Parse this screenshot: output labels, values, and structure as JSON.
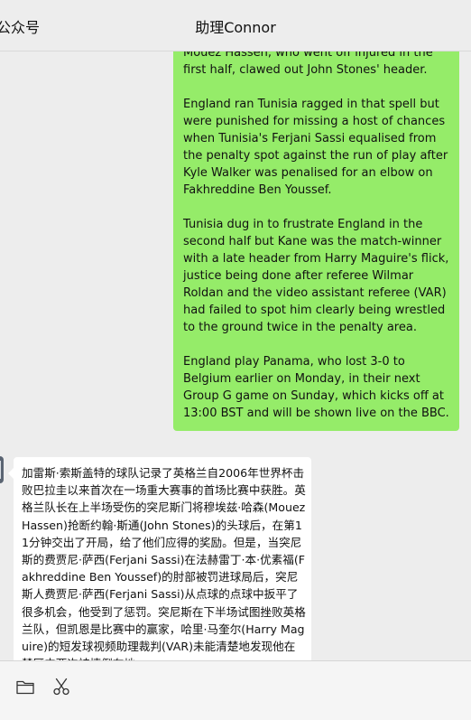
{
  "header": {
    "back_label": "公众号",
    "title": "助理Connor"
  },
  "messages": [
    {
      "direction": "out",
      "paragraphs": [
        "Mouez Hassen, who went off injured in the first half, clawed out John Stones' header.",
        "England ran Tunisia ragged in that spell but were punished for missing a host of chances when Tunisia's Ferjani Sassi equalised from the penalty spot against the run of play after Kyle Walker was penalised for an elbow on Fakhreddine Ben Youssef.",
        "Tunisia dug in to frustrate England in the second half but Kane was the match-winner with a late header from Harry Maguire's flick, justice being done after referee Wilmar Roldan and the video assistant referee (VAR) had failed to spot him clearly being wrestled to the ground twice in the penalty area.",
        "England play Panama, who lost 3-0 to Belgium earlier on Monday, in their next Group G game on Sunday, which kicks off at 13:00 BST and will be shown live on the BBC."
      ]
    },
    {
      "direction": "in",
      "paragraphs": [
        "加雷斯·索斯盖特的球队记录了英格兰自2006年世界杯击败巴拉圭以来首次在一场重大赛事的首场比赛中获胜。英格兰队长在上半场受伤的突尼斯门将穆埃兹·哈森(Mouez Hassen)抢断约翰·斯通(John Stones)的头球后，在第11分钟交出了开局，给了他们应得的奖励。但是，当突尼斯的费贾尼·萨西(Ferjani Sassi)在法赫雷丁·本·优素福(Fakhreddine Ben Youssef)的肘部被罚进球局后，突尼斯人费贾尼·萨西(Ferjani Sassi)从点球的点球中扳平了很多机会，他受到了惩罚。突尼斯在下半场试图挫败英格兰队，但凯恩是比赛中的赢家，哈里·马奎尔(Harry Maguire)的短发球视频助理裁判(VAR)未能清楚地发现他在禁区内两次被摔倒在地。"
      ]
    }
  ],
  "toolbar": {
    "items": [
      "folder-icon",
      "scissors-icon"
    ]
  }
}
